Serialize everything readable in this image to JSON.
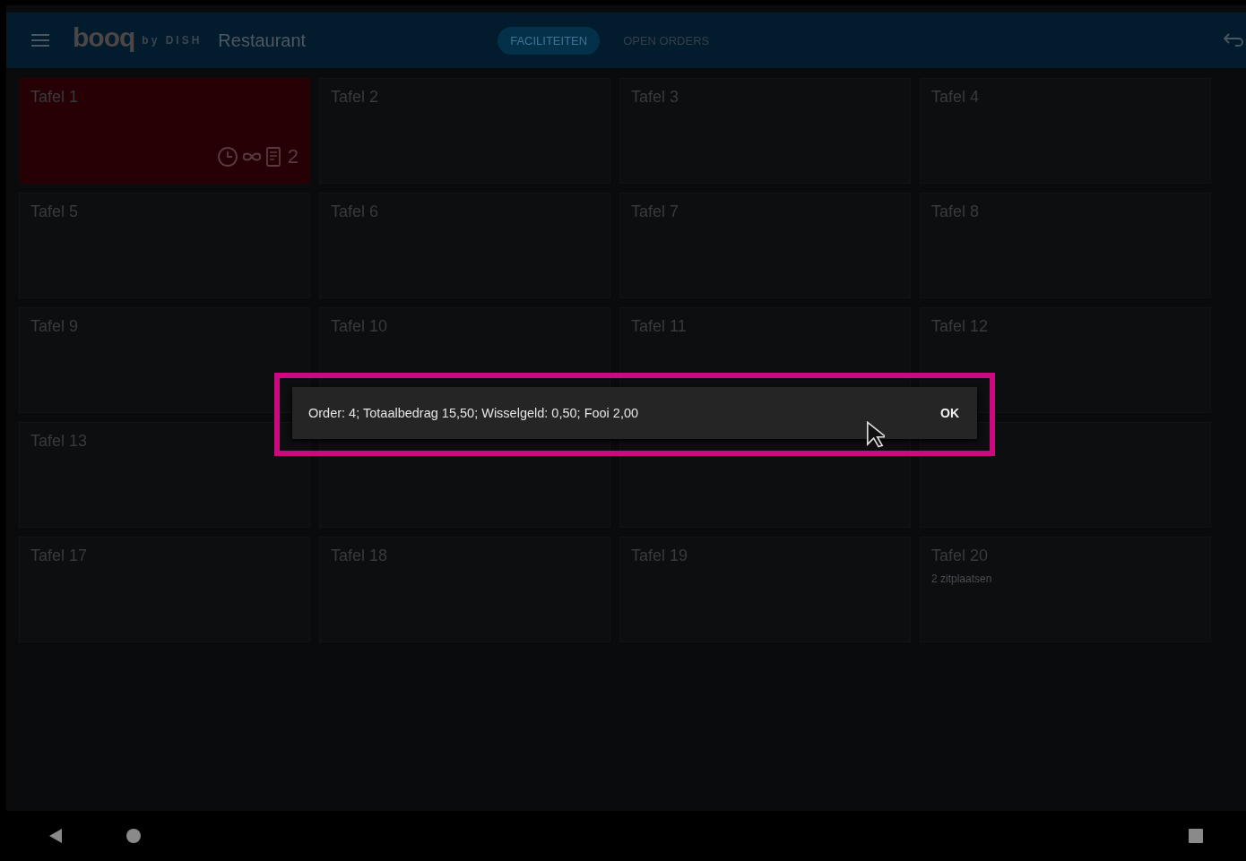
{
  "header": {
    "logo": "booq",
    "logo_suffix": "by DISH",
    "title": "Restaurant",
    "tabs": [
      {
        "label": "FACILITEITEN",
        "selected": true
      },
      {
        "label": "OPEN ORDERS",
        "selected": false
      }
    ]
  },
  "tables": [
    {
      "label": "Tafel 1",
      "selected": true,
      "order_count": "2"
    },
    {
      "label": "Tafel 2",
      "selected": false
    },
    {
      "label": "Tafel 3",
      "selected": false
    },
    {
      "label": "Tafel 4",
      "selected": false
    },
    {
      "label": "Tafel 5",
      "selected": false
    },
    {
      "label": "Tafel 6",
      "selected": false
    },
    {
      "label": "Tafel 7",
      "selected": false
    },
    {
      "label": "Tafel 8",
      "selected": false
    },
    {
      "label": "Tafel 9",
      "selected": false
    },
    {
      "label": "Tafel 10",
      "selected": false
    },
    {
      "label": "Tafel 11",
      "selected": false
    },
    {
      "label": "Tafel 12",
      "selected": false
    },
    {
      "label": "Tafel 13",
      "selected": false
    },
    {
      "selected": false
    },
    {
      "selected": false
    },
    {
      "selected": false
    },
    {
      "label": "Tafel 17",
      "selected": false
    },
    {
      "label": "Tafel 18",
      "selected": false
    },
    {
      "label": "Tafel 19",
      "selected": false
    },
    {
      "label": "Tafel 20",
      "selected": false,
      "seats": "2 zitplaatsen"
    }
  ],
  "snackbar": {
    "message": "Order: 4; Totaalbedrag 15,50; Wisselgeld: 0,50; Fooi 2,00",
    "action": "OK"
  }
}
